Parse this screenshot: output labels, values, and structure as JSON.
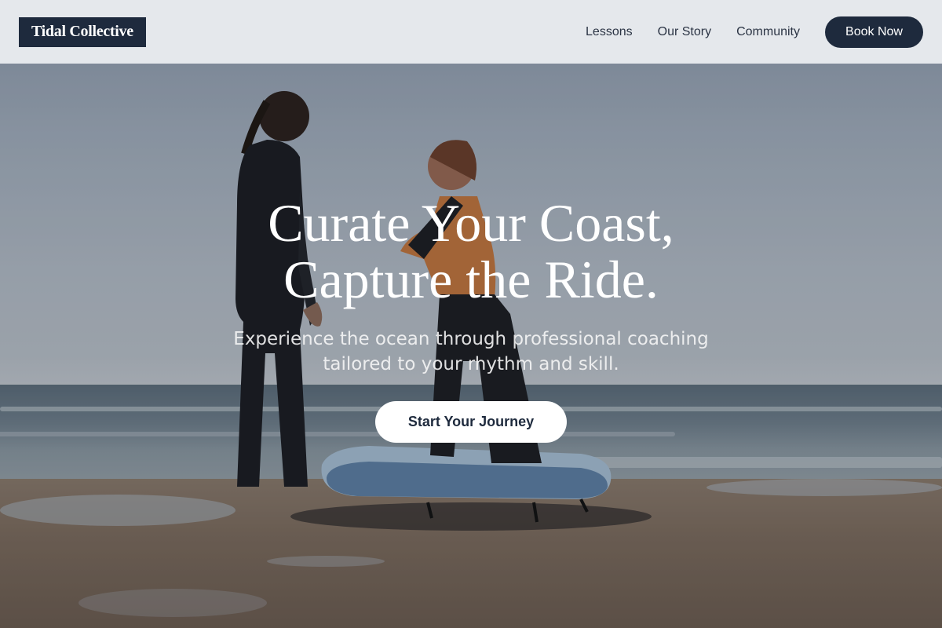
{
  "header": {
    "brand": "Tidal Collective",
    "nav": [
      {
        "label": "Lessons"
      },
      {
        "label": "Our Story"
      },
      {
        "label": "Community"
      }
    ],
    "cta_label": "Book Now"
  },
  "hero": {
    "headline_line1": "Curate Your Coast,",
    "headline_line2": "Capture the Ride.",
    "subtext_line1": "Experience the ocean through professional coaching",
    "subtext_line2": "tailored to your rhythm and skill.",
    "cta_label": "Start Your Journey",
    "background_image": "two-surfers-on-beach-photo"
  },
  "colors": {
    "brand_navy": "#1e2a3d",
    "header_bg": "#eceef1",
    "cta_bg": "#ffffff"
  }
}
